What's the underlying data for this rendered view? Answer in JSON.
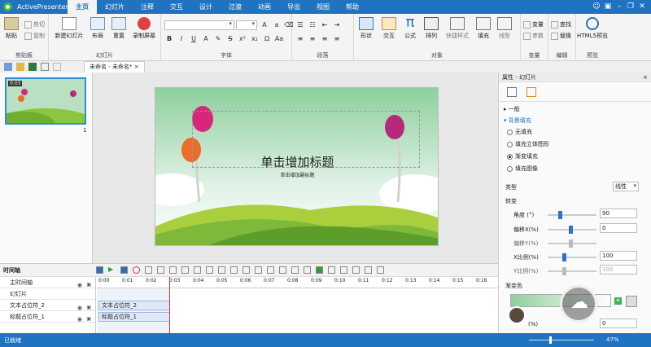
{
  "app": {
    "name": "ActivePresenter"
  },
  "menu": [
    "主页",
    "幻灯片",
    "注释",
    "交互",
    "设计",
    "过渡",
    "动画",
    "导出",
    "视图",
    "帮助"
  ],
  "ribbon": {
    "clipboard": {
      "label": "剪贴板",
      "paste": "粘贴",
      "cut": "剪切",
      "copy": "复制"
    },
    "slides": {
      "label": "幻灯片",
      "new_slide": "新建幻灯片",
      "layout": "布局",
      "reset": "重置",
      "record": "录制屏幕"
    },
    "font": {
      "label": "字体"
    },
    "paragraph": {
      "label": "段落"
    },
    "objects": {
      "label": "对象",
      "shape": "形状",
      "interaction": "交互",
      "formula": "公式",
      "arrange": "排列",
      "quick_style": "快捷样式",
      "fill": "填充",
      "line": "线型"
    },
    "variables": {
      "label": "变量",
      "variable": "变量",
      "param": "参数"
    },
    "edit": {
      "label": "编辑",
      "find": "查找",
      "replace": "替换"
    },
    "preview": {
      "label": "预览",
      "html5": "HTML5预览"
    }
  },
  "document": {
    "tab": "未命名 - 未命名*"
  },
  "thumbnail": {
    "time": "0:03",
    "number": "1"
  },
  "slide": {
    "title": "单击增加标题",
    "subtitle": "单击增加副标题"
  },
  "properties": {
    "header": "属性 - 幻灯片",
    "general": "一般",
    "bg_fill": "背景填充",
    "fill_options": [
      "无填充",
      "填充立体图形",
      "渐变填充",
      "填充图像"
    ],
    "selected_fill": 2,
    "type_label": "类型",
    "type_value": "线性",
    "transform_label": "转变",
    "angle_label": "角度 (°)",
    "angle_value": "90",
    "offset_x_label": "偏移X(%)",
    "offset_x_value": "0",
    "offset_y_label": "偏移Y(%)",
    "scale_x_label": "X比例(%)",
    "scale_x_value": "100",
    "scale_y_label": "Y比例(%)",
    "scale_y_value": "100",
    "gradient_label": "渐变色",
    "pct_label": "(%)",
    "pct_value": "0"
  },
  "timeline": {
    "title": "时间轴",
    "rows": [
      "主时间轴",
      "幻灯片",
      "文本占位符_2",
      "标题占位符_1"
    ],
    "ticks": [
      "0:00",
      "0:01",
      "0:02",
      "0:03",
      "0:04",
      "0:05",
      "0:06",
      "0:07",
      "0:08",
      "0:09",
      "0:10",
      "0:11",
      "0:12",
      "0:13",
      "0:14",
      "0:15",
      "0:16"
    ],
    "segments": [
      "文本占位符_2",
      "标题占位符_1"
    ]
  },
  "status": {
    "text": "已就绪",
    "zoom": "47%"
  }
}
